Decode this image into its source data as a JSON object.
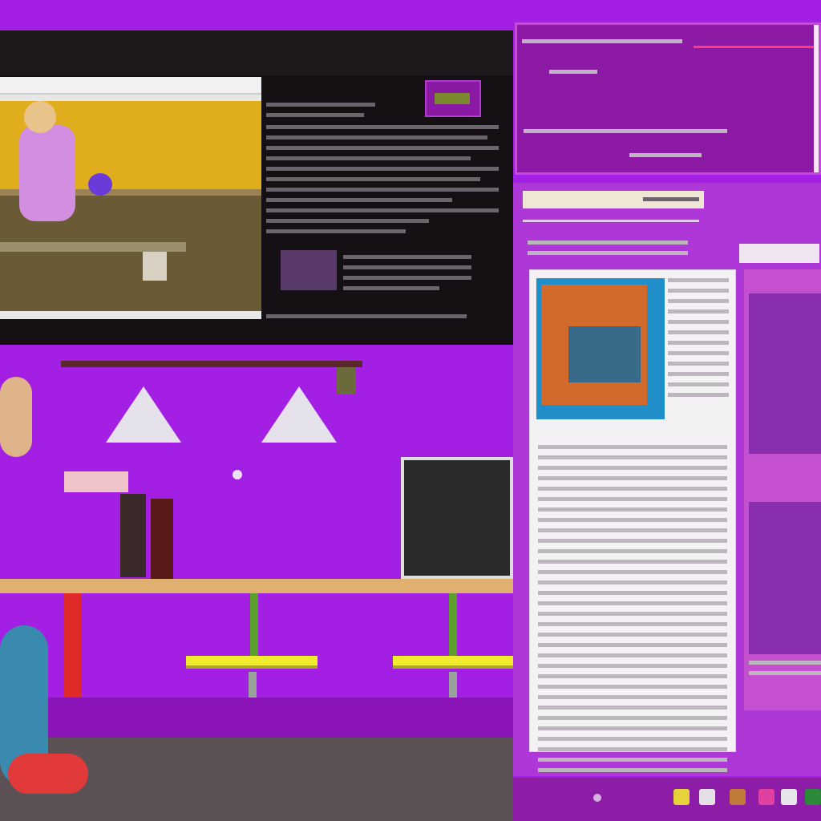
{
  "top_left": {
    "window_title": "",
    "side_title": ""
  },
  "top_right": {
    "header_text": "",
    "row_text": ""
  },
  "doc": {
    "heading": "",
    "subheading": ""
  },
  "colors": {
    "background": "#a31fe3",
    "accent": "#ff3b7a"
  }
}
